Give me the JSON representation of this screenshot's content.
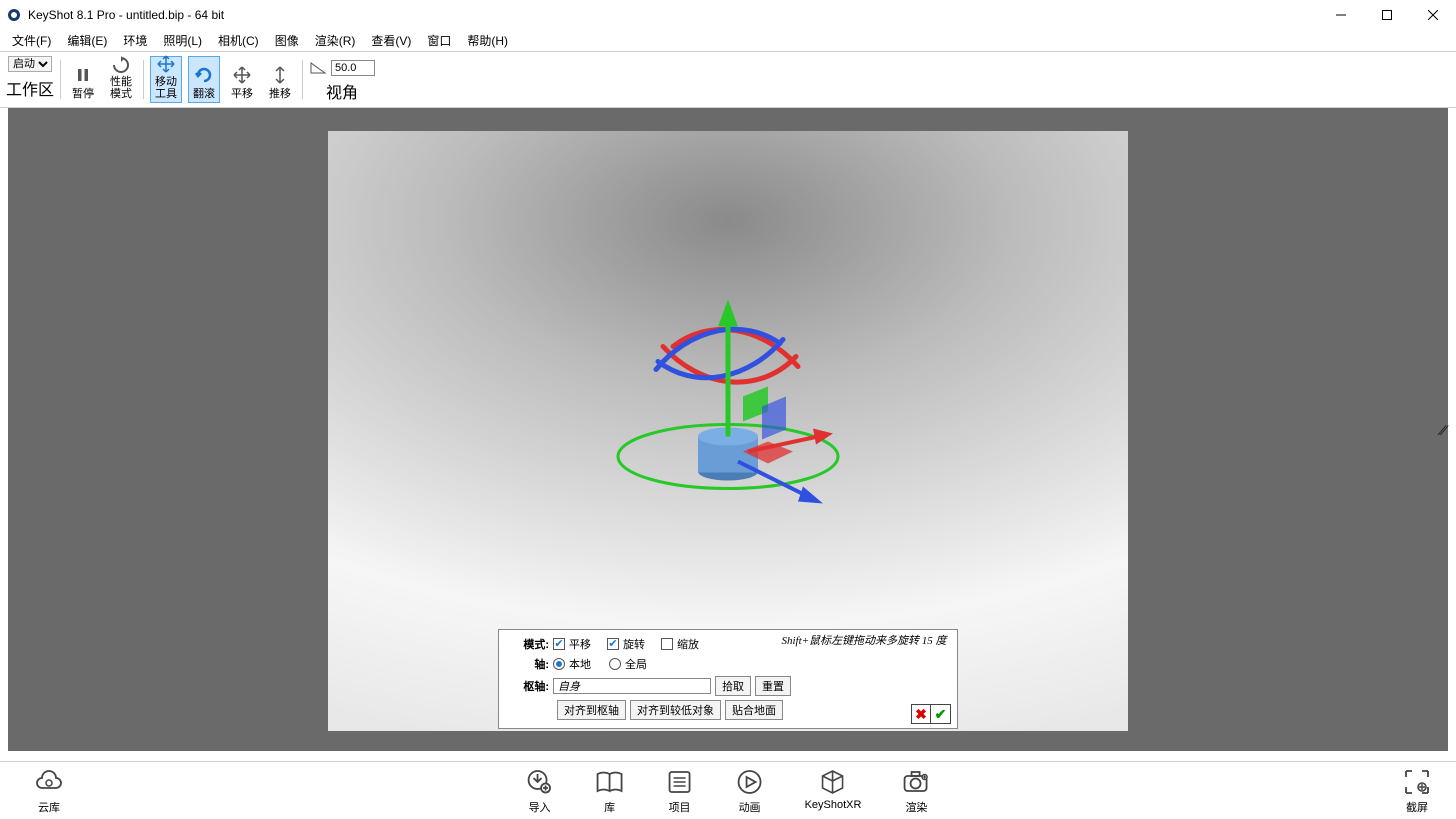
{
  "titlebar": {
    "title": "KeyShot 8.1 Pro  - untitled.bip  - 64 bit"
  },
  "menubar": {
    "items": [
      "文件(F)",
      "编辑(E)",
      "环境",
      "照明(L)",
      "相机(C)",
      "图像",
      "渲染(R)",
      "查看(V)",
      "窗口",
      "帮助(H)"
    ]
  },
  "toolbar": {
    "dropdown": "启动",
    "workspace": "工作区",
    "pause": "暂停",
    "perfmode": "性能\n模式",
    "movetool": "移动\n工具",
    "tumble": "翻滚",
    "pan": "平移",
    "dolly": "推移",
    "fov_label": "视角",
    "fov_value": "50.0"
  },
  "panel": {
    "mode_label": "模式:",
    "mode_translate": "平移",
    "mode_rotate": "旋转",
    "mode_scale": "缩放",
    "hint": "Shift+鼠标左键拖动来多旋转 15 度",
    "axis_label": "轴:",
    "axis_local": "本地",
    "axis_global": "全局",
    "pivot_label": "枢轴:",
    "pivot_value": "自身",
    "pick": "拾取",
    "reset": "重置",
    "align_pivot": "对齐到枢轴",
    "align_lower": "对齐到较低对象",
    "snap_ground": "贴合地面"
  },
  "bottombar": {
    "cloud": "云库",
    "import": "导入",
    "library": "库",
    "project": "项目",
    "animation": "动画",
    "keyshotxr": "KeyShotXR",
    "render": "渲染",
    "screenshot": "截屏"
  }
}
